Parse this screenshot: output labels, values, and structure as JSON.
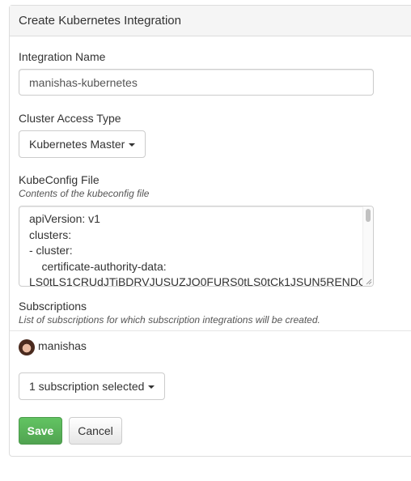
{
  "panel": {
    "title": "Create Kubernetes Integration"
  },
  "form": {
    "integration_name": {
      "label": "Integration Name",
      "value": "manishas-kubernetes"
    },
    "cluster_access_type": {
      "label": "Cluster Access Type",
      "selected": "Kubernetes Master"
    },
    "kubeconfig": {
      "label": "KubeConfig File",
      "help": "Contents of the kubeconfig file",
      "lines": [
        "apiVersion: v1",
        "clusters:",
        "- cluster:",
        "    certificate-authority-data:",
        "LS0tLS1CRUdJTiBDRVJUSUZJQ0FURS0tLS0tCk1JSUN5RENDQ"
      ]
    },
    "subscriptions": {
      "label": "Subscriptions",
      "help": "List of subscriptions for which subscription integrations will be created.",
      "user": "manishas",
      "selected": "1 subscription selected"
    }
  },
  "actions": {
    "save_label": "Save",
    "cancel_label": "Cancel"
  },
  "colors": {
    "save_button": "#5cb85c",
    "panel_heading_bg": "#f5f5f5"
  }
}
